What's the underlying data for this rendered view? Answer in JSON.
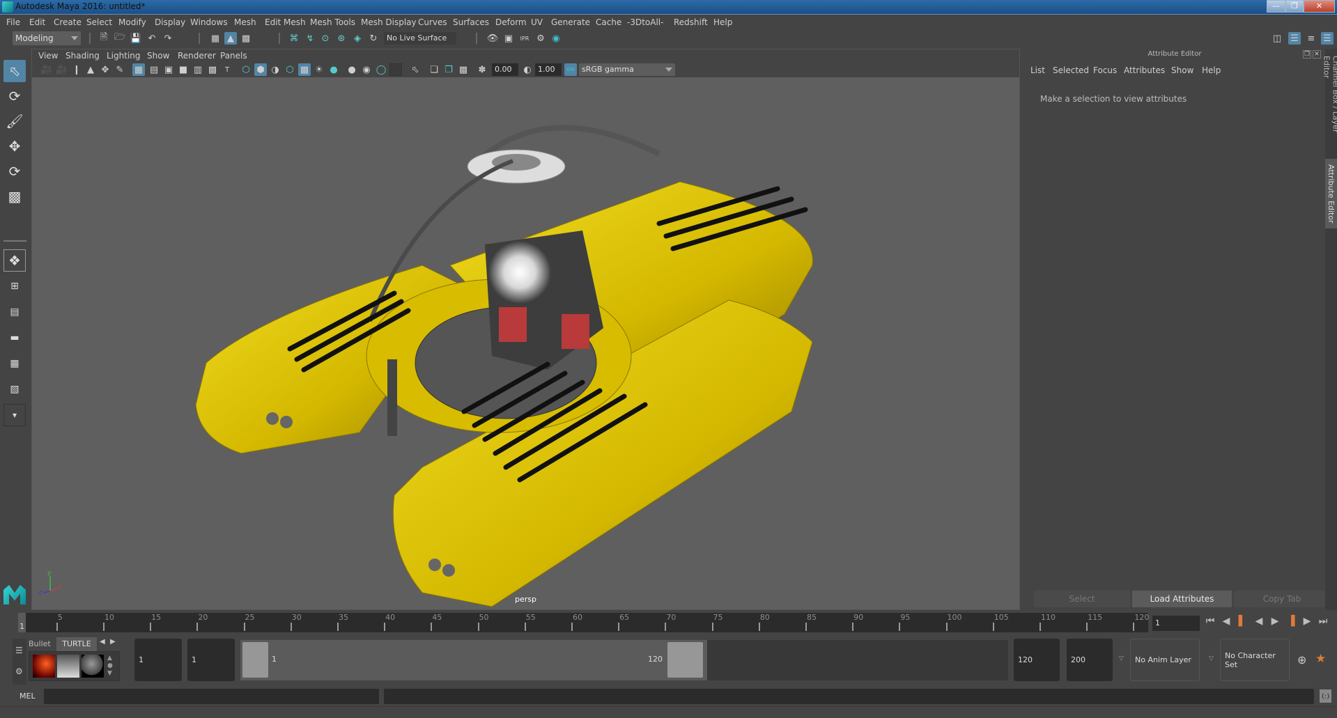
{
  "window": {
    "title": "Autodesk Maya 2016: untitled*",
    "controls": [
      "minimize",
      "restore",
      "close"
    ]
  },
  "menubar": [
    "File",
    "Edit",
    "Create",
    "Select",
    "Modify",
    "Display",
    "Windows",
    "Mesh",
    "Edit Mesh",
    "Mesh Tools",
    "Mesh Display",
    "Curves",
    "Surfaces",
    "Deform",
    "UV",
    "Generate",
    "Cache",
    "-3DtoAll-",
    "Redshift",
    "Help"
  ],
  "statusline": {
    "menuset": "Modeling",
    "live_surface": "No Live Surface",
    "icons": [
      "new-scene-icon",
      "open-scene-icon",
      "save-scene-icon",
      "undo-icon",
      "redo-icon",
      "select-by-hierarchy-icon",
      "select-by-object-icon",
      "select-by-component-icon",
      "snap-grid-icon",
      "snap-curve-icon",
      "snap-point-icon",
      "snap-view-plane-icon",
      "snap-live-icon",
      "make-live-icon",
      "render-view-icon",
      "render-current-icon",
      "ipr-render-icon",
      "render-settings-icon",
      "hypershade-icon"
    ]
  },
  "toolbox": {
    "tools": [
      "select-tool",
      "lasso-tool",
      "paint-select-tool",
      "move-tool",
      "rotate-tool",
      "scale-tool"
    ],
    "layouts": [
      "single-perspective-layout",
      "four-view-layout",
      "persp-outliner-layout",
      "persp-graph-layout",
      "hypershade-persp-layout",
      "persp-graph-hypershade-layout",
      "more-layouts"
    ]
  },
  "viewport": {
    "menus": [
      "View",
      "Shading",
      "Lighting",
      "Show",
      "Renderer",
      "Panels"
    ],
    "exposure": "0.00",
    "gamma": "1.00",
    "colorspace_toggle": "ON",
    "colorspace": "sRGB gamma",
    "camera_label": "persp",
    "axis": {
      "x": "x",
      "y": "y",
      "z": "z"
    },
    "scene_description": "Yellow Triton-style submersible model with cockpit, pontoons and manipulator arm"
  },
  "attribute_editor": {
    "title": "Attribute Editor",
    "menus": [
      "List",
      "Selected",
      "Focus",
      "Attributes",
      "Show",
      "Help"
    ],
    "message": "Make a selection to view attributes",
    "buttons": {
      "select": "Select",
      "load": "Load Attributes",
      "copy": "Copy Tab"
    }
  },
  "side_tabs": [
    "Channel Box / Layer Editor",
    "Attribute Editor"
  ],
  "timeline": {
    "start": 1,
    "end": 120,
    "current_frame": "1",
    "labels": [
      "5",
      "10",
      "15",
      "20",
      "25",
      "30",
      "35",
      "40",
      "45",
      "50",
      "55",
      "60",
      "65",
      "70",
      "75",
      "80",
      "85",
      "90",
      "95",
      "100",
      "105",
      "110",
      "115",
      "120"
    ]
  },
  "shelf": {
    "tabs": [
      "Bullet",
      "TURTLE"
    ],
    "active_tab": "TURTLE"
  },
  "range": {
    "anim_start": "1",
    "playback_start": "1",
    "slider_start": "1",
    "slider_end": "120",
    "playback_end": "120",
    "anim_end": "200",
    "anim_layer": "No Anim Layer",
    "character_set": "No Character Set"
  },
  "commandline": {
    "language": "MEL",
    "value": "",
    "result": ""
  },
  "colors": {
    "accent": "#5285a6",
    "maya_teal": "#22b8c4",
    "key_marker": "#e07b39",
    "sub_yellow": "#e0c400"
  }
}
